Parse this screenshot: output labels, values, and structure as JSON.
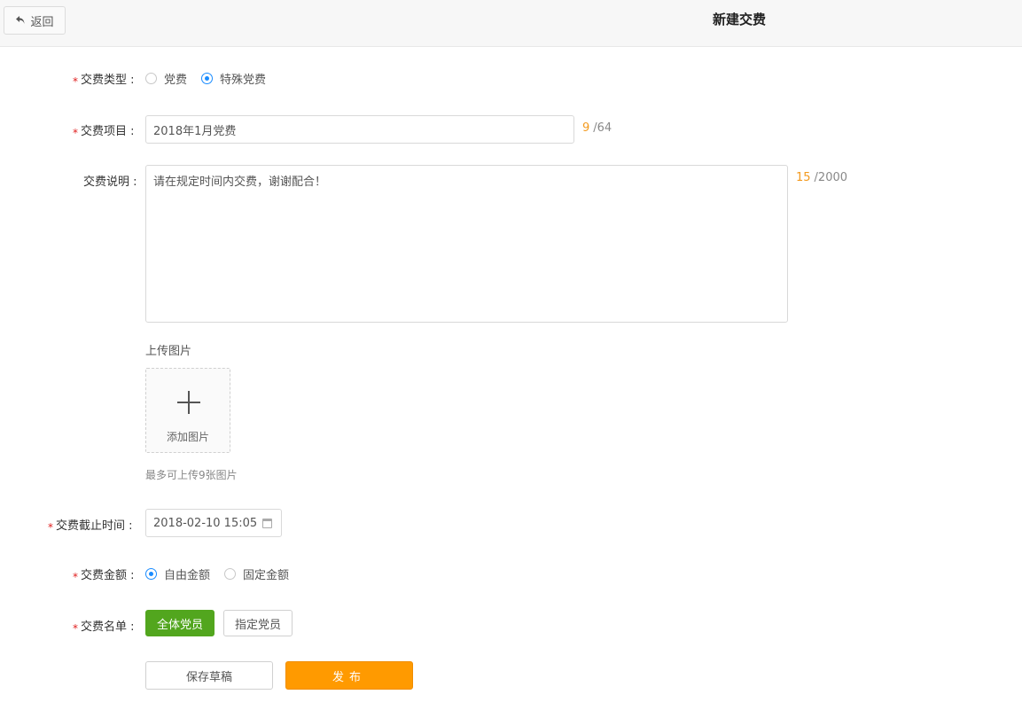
{
  "header": {
    "back_label": "返回",
    "title": "新建交费"
  },
  "form": {
    "required_mark": "*",
    "type": {
      "label": "交费类型 :",
      "options": [
        {
          "label": "党费",
          "checked": false
        },
        {
          "label": "特殊党费",
          "checked": true
        }
      ]
    },
    "item": {
      "label": "交费项目 :",
      "value": "2018年1月党费",
      "count": "9",
      "max": "/64"
    },
    "desc": {
      "label": "交费说明 :",
      "value": "请在规定时间内交费，谢谢配合！",
      "count": "15",
      "max": "/2000"
    },
    "upload": {
      "title": "上传图片",
      "add_label": "添加图片",
      "hint": "最多可上传9张图片"
    },
    "deadline": {
      "label": "交费截止时间 :",
      "value": "2018-02-10 15:05"
    },
    "amount": {
      "label": "交费金额 :",
      "options": [
        {
          "label": "自由金额",
          "checked": true
        },
        {
          "label": "固定金额",
          "checked": false
        }
      ]
    },
    "list": {
      "label": "交费名单 :",
      "all_label": "全体党员",
      "specific_label": "指定党员"
    }
  },
  "actions": {
    "draft_label": "保存草稿",
    "publish_label": "发布"
  },
  "colors": {
    "accent_blue": "#1a8cff",
    "publish_orange": "#ff9a00",
    "active_green": "#52a61e",
    "required_red": "#e02020",
    "counter_orange": "#f39a1e"
  }
}
